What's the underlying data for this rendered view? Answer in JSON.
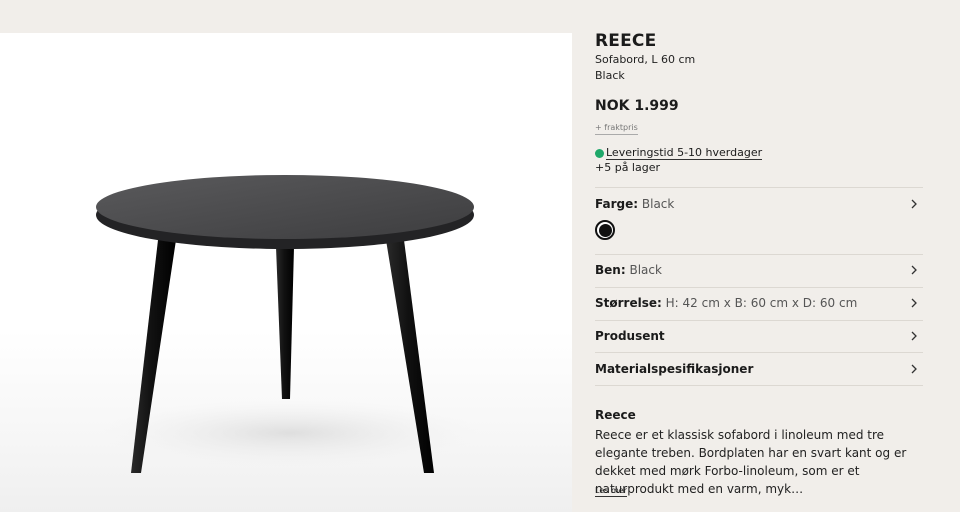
{
  "product": {
    "name": "REECE",
    "subtitle": "Sofabord, L 60 cm",
    "color": "Black",
    "price": "NOK 1.999",
    "freight": "+ fraktpris",
    "delivery": "Leveringstid 5-10 hverdager",
    "stock": "+5 på lager",
    "status_color": "#1fa86a"
  },
  "options": [
    {
      "label": "Farge:",
      "value": "Black"
    },
    {
      "label": "Ben:",
      "value": "Black"
    },
    {
      "label": "Størrelse:",
      "value": "H: 42 cm x B: 60 cm x D: 60 cm"
    },
    {
      "label": "Produsent",
      "value": ""
    },
    {
      "label": "Materialspesifikasjoner",
      "value": ""
    }
  ],
  "description": {
    "title": "Reece",
    "text": "Reece er et klassisk sofabord i linoleum med tre elegante treben. Bordplaten har en svart kant og er dekket med mørk Forbo-linoleum, som er et naturprodukt med en varm, myk…",
    "more": "Les mer"
  },
  "icons": {
    "chevron": "chevron-right-icon",
    "status": "green-dot-icon"
  }
}
